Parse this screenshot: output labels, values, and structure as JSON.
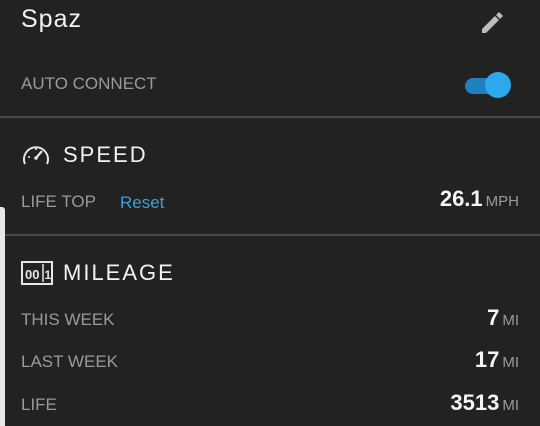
{
  "device": {
    "name": "Spaz",
    "edit_icon": "pencil-icon"
  },
  "auto_connect": {
    "label": "AUTO CONNECT",
    "enabled": true,
    "accent_color": "#2ea8ec"
  },
  "speed": {
    "icon": "speedometer-icon",
    "title": "SPEED",
    "life_top_label": "LIFE TOP",
    "reset_label": "Reset",
    "life_top_value": "26.1",
    "life_top_unit": "MPH"
  },
  "mileage": {
    "icon": "odometer-icon",
    "title": "MILEAGE",
    "rows": [
      {
        "label": "THIS WEEK",
        "value": "7",
        "unit": "MI"
      },
      {
        "label": "LAST WEEK",
        "value": "17",
        "unit": "MI"
      },
      {
        "label": "LIFE",
        "value": "3513",
        "unit": "MI"
      }
    ]
  }
}
